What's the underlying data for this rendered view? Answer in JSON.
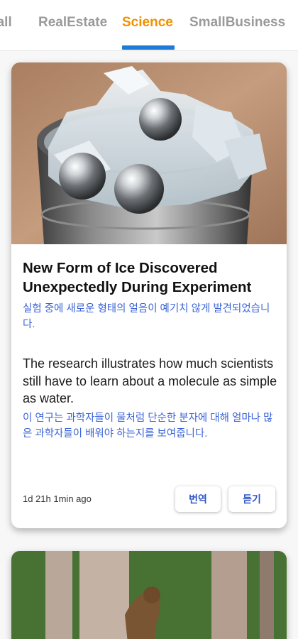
{
  "tabs": [
    {
      "label": "ball"
    },
    {
      "label": "RealEstate"
    },
    {
      "label": "Science",
      "active": true
    },
    {
      "label": "SmallBusiness"
    }
  ],
  "colors": {
    "active_tab": "#f29100",
    "indicator": "#1e7bd8",
    "translation_text": "#3a63d6"
  },
  "article": {
    "title": "New Form of Ice Discovered Unexpectedly During Experiment",
    "title_kr": "실험 중에 새로운 형태의 얼음이 예기치 않게 발견되었습니다.",
    "summary": "The research illustrates how much scientists still have to learn about a molecule as simple as water.",
    "summary_kr": "이 연구는 과학자들이 물처럼 단순한 분자에 대해 얼마나 많은 과학자들이 배워야 하는지를 보여줍니다.",
    "timestamp": "1d 21h 1min ago",
    "translate_label": "번역",
    "listen_label": "듣기"
  }
}
